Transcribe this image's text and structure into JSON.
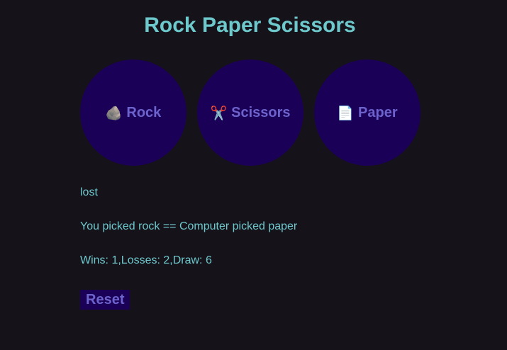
{
  "app": {
    "title": "Rock Paper Scissors"
  },
  "choices": [
    {
      "icon": "rock-icon",
      "glyph": "🪨",
      "label": "Rock"
    },
    {
      "icon": "scissors-icon",
      "glyph": "✂️",
      "label": "Scissors"
    },
    {
      "icon": "paper-icon",
      "glyph": "📄",
      "label": "Paper"
    }
  ],
  "result": {
    "outcome": "lost",
    "picks": "You picked rock == Computer picked paper",
    "score": "Wins: 1,Losses: 2,Draw: 6"
  },
  "controls": {
    "reset_label": "Reset"
  },
  "colors": {
    "background": "#15121a",
    "accent_text": "#6ec9cc",
    "button_bg": "#1b0058",
    "button_text": "#6d63cc"
  }
}
